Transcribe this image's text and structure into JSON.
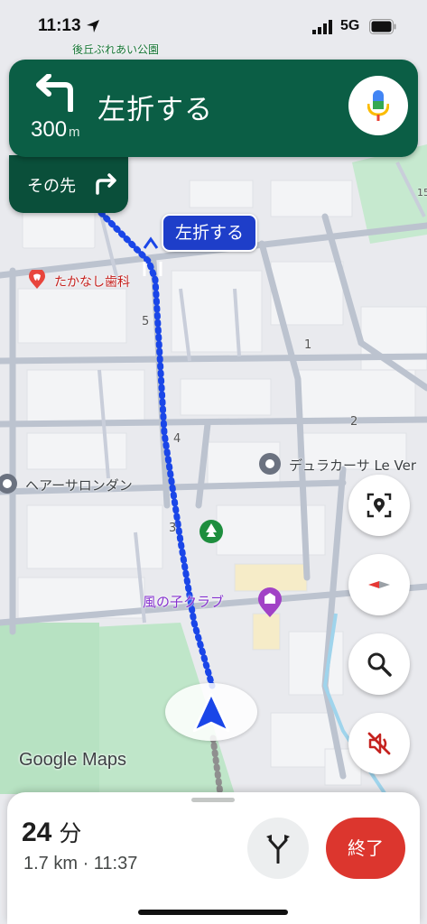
{
  "status_bar": {
    "time": "11:13",
    "network": "5G",
    "icons": [
      "location-arrow-icon",
      "signal-icon",
      "battery-icon"
    ]
  },
  "navigation": {
    "instruction": "左折する",
    "distance_value": "300",
    "distance_unit": "m",
    "then_label": "その先",
    "turn_icon": "turn-left-icon",
    "then_icon": "turn-right-icon",
    "mic_icon": "microphone-icon"
  },
  "map": {
    "callout": "左折する",
    "labels": {
      "dentist": "たかなし歯科",
      "salon": "ヘアーサロンダン",
      "apartment": "デュラカーサ Le Ver",
      "club": "風の子クラブ",
      "park_top": "後丘ぶれあい公園"
    },
    "street_numbers": [
      "5",
      "4",
      "3",
      "1",
      "2",
      "15"
    ],
    "route_color": "#1a46e8",
    "park_color": "#bfe6c9"
  },
  "controls": {
    "buttons": [
      "location-search-icon",
      "compass-icon",
      "search-icon",
      "sound-off-icon"
    ]
  },
  "branding": {
    "logo": "Google Maps"
  },
  "trip": {
    "duration_value": "24",
    "duration_unit": "分",
    "details": "1.7 km · 11:37",
    "end_label": "終了",
    "route_icon": "route-options-icon"
  }
}
